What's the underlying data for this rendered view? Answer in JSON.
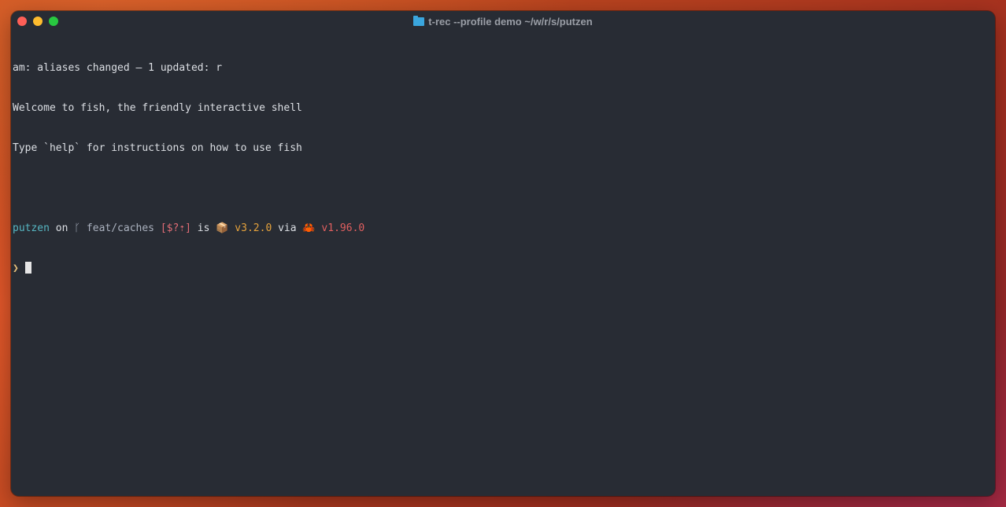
{
  "window": {
    "title": "t-rec --profile demo ~/w/r/s/putzen",
    "title_icon": "folder-icon"
  },
  "terminal": {
    "lines": [
      "am: aliases changed — 1 updated: r",
      "Welcome to fish, the friendly interactive shell",
      "Type `help` for instructions on how to use fish",
      ""
    ],
    "prompt": {
      "directory": "putzen",
      "on_word": " on ",
      "branch_icon": "ᚴ",
      "branch": " feat/caches ",
      "git_status": "[$?⇡]",
      "is_word": " is ",
      "package_icon": "📦",
      "package_version": " v3.2.0",
      "via_word": " via ",
      "rust_icon": "🦀",
      "rust_version": " v1.96.0",
      "prompt_char": "❯"
    }
  },
  "colors": {
    "terminal_bg": "#282c34",
    "directory": "#56b6c2",
    "git_status": "#e06c75",
    "package": "#e5a23c",
    "rust": "#e05f5f",
    "prompt_char": "#e5c07b"
  }
}
